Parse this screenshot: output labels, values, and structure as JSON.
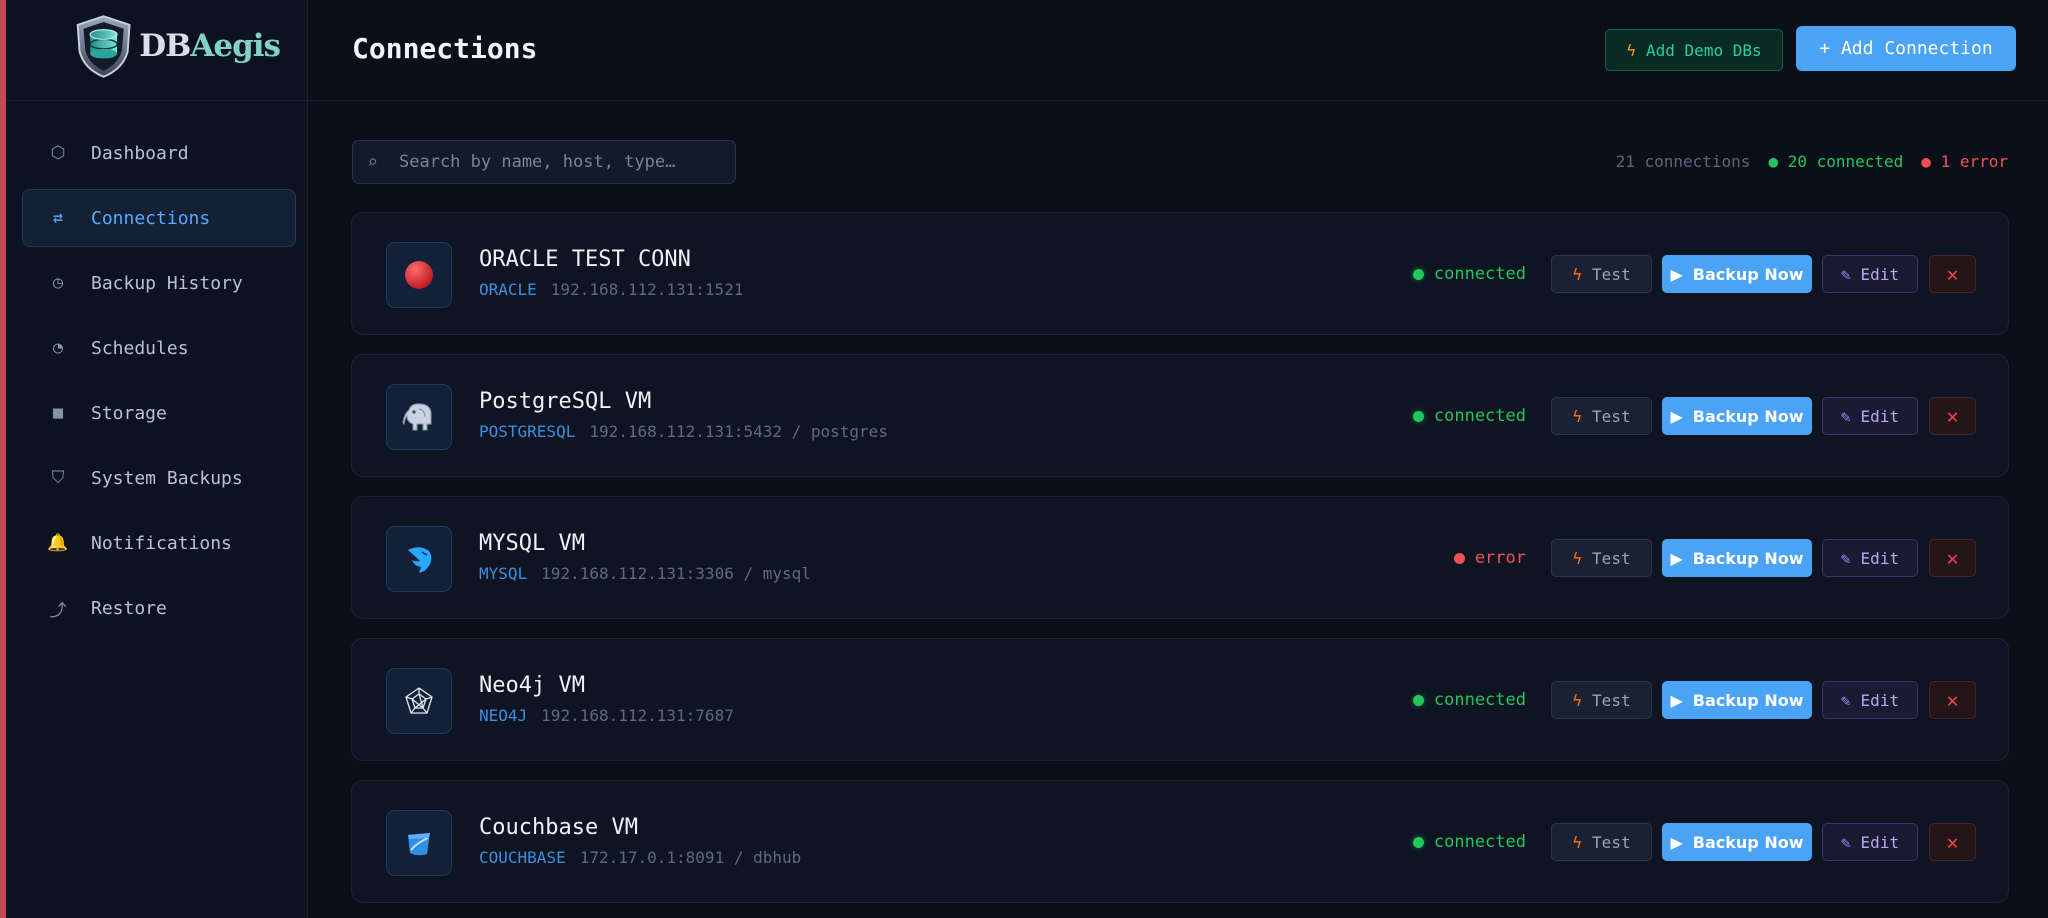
{
  "app": {
    "brand_db": "DB",
    "brand_aegis": "Aegis"
  },
  "sidebar": {
    "items": [
      {
        "label": "Dashboard",
        "icon": "hexagon-icon",
        "glyph": "⬡",
        "active": false
      },
      {
        "label": "Connections",
        "icon": "swap-arrows-icon",
        "glyph": "⇄",
        "active": true
      },
      {
        "label": "Backup History",
        "icon": "clock-icon",
        "glyph": "◷",
        "active": false
      },
      {
        "label": "Schedules",
        "icon": "pie-clock-icon",
        "glyph": "◔",
        "active": false
      },
      {
        "label": "Storage",
        "icon": "square-icon",
        "glyph": "■",
        "active": false
      },
      {
        "label": "System Backups",
        "icon": "shield-icon",
        "glyph": "⛉",
        "active": false
      },
      {
        "label": "Notifications",
        "icon": "bell-icon",
        "glyph": "🔔",
        "active": false
      },
      {
        "label": "Restore",
        "icon": "restore-arrow-icon",
        "glyph": "⤴",
        "active": false
      }
    ]
  },
  "header": {
    "title": "Connections",
    "demo_label": "Add Demo DBs",
    "add_label": "+ Add Connection"
  },
  "search": {
    "placeholder": "Search by name, host, type…",
    "value": ""
  },
  "stats": {
    "total": "21 connections",
    "connected": "● 20 connected",
    "error": "● 1 error"
  },
  "buttons": {
    "test": "Test",
    "backup": "Backup Now",
    "edit": "Edit",
    "delete": "✕"
  },
  "connections": [
    {
      "name": "ORACLE TEST CONN",
      "type": "ORACLE",
      "address": "192.168.112.131:1521",
      "status": "connected",
      "icon": "oracle-icon"
    },
    {
      "name": "PostgreSQL VM",
      "type": "POSTGRESQL",
      "address": "192.168.112.131:5432 / postgres",
      "status": "connected",
      "icon": "postgresql-elephant-icon"
    },
    {
      "name": "MYSQL VM",
      "type": "MYSQL",
      "address": "192.168.112.131:3306 / mysql",
      "status": "error",
      "icon": "mysql-dolphin-icon"
    },
    {
      "name": "Neo4j VM",
      "type": "NEO4J",
      "address": "192.168.112.131:7687",
      "status": "connected",
      "icon": "neo4j-graph-icon"
    },
    {
      "name": "Couchbase VM",
      "type": "COUCHBASE",
      "address": "172.17.0.1:8091 / dbhub",
      "status": "connected",
      "icon": "couchbase-icon"
    }
  ]
}
